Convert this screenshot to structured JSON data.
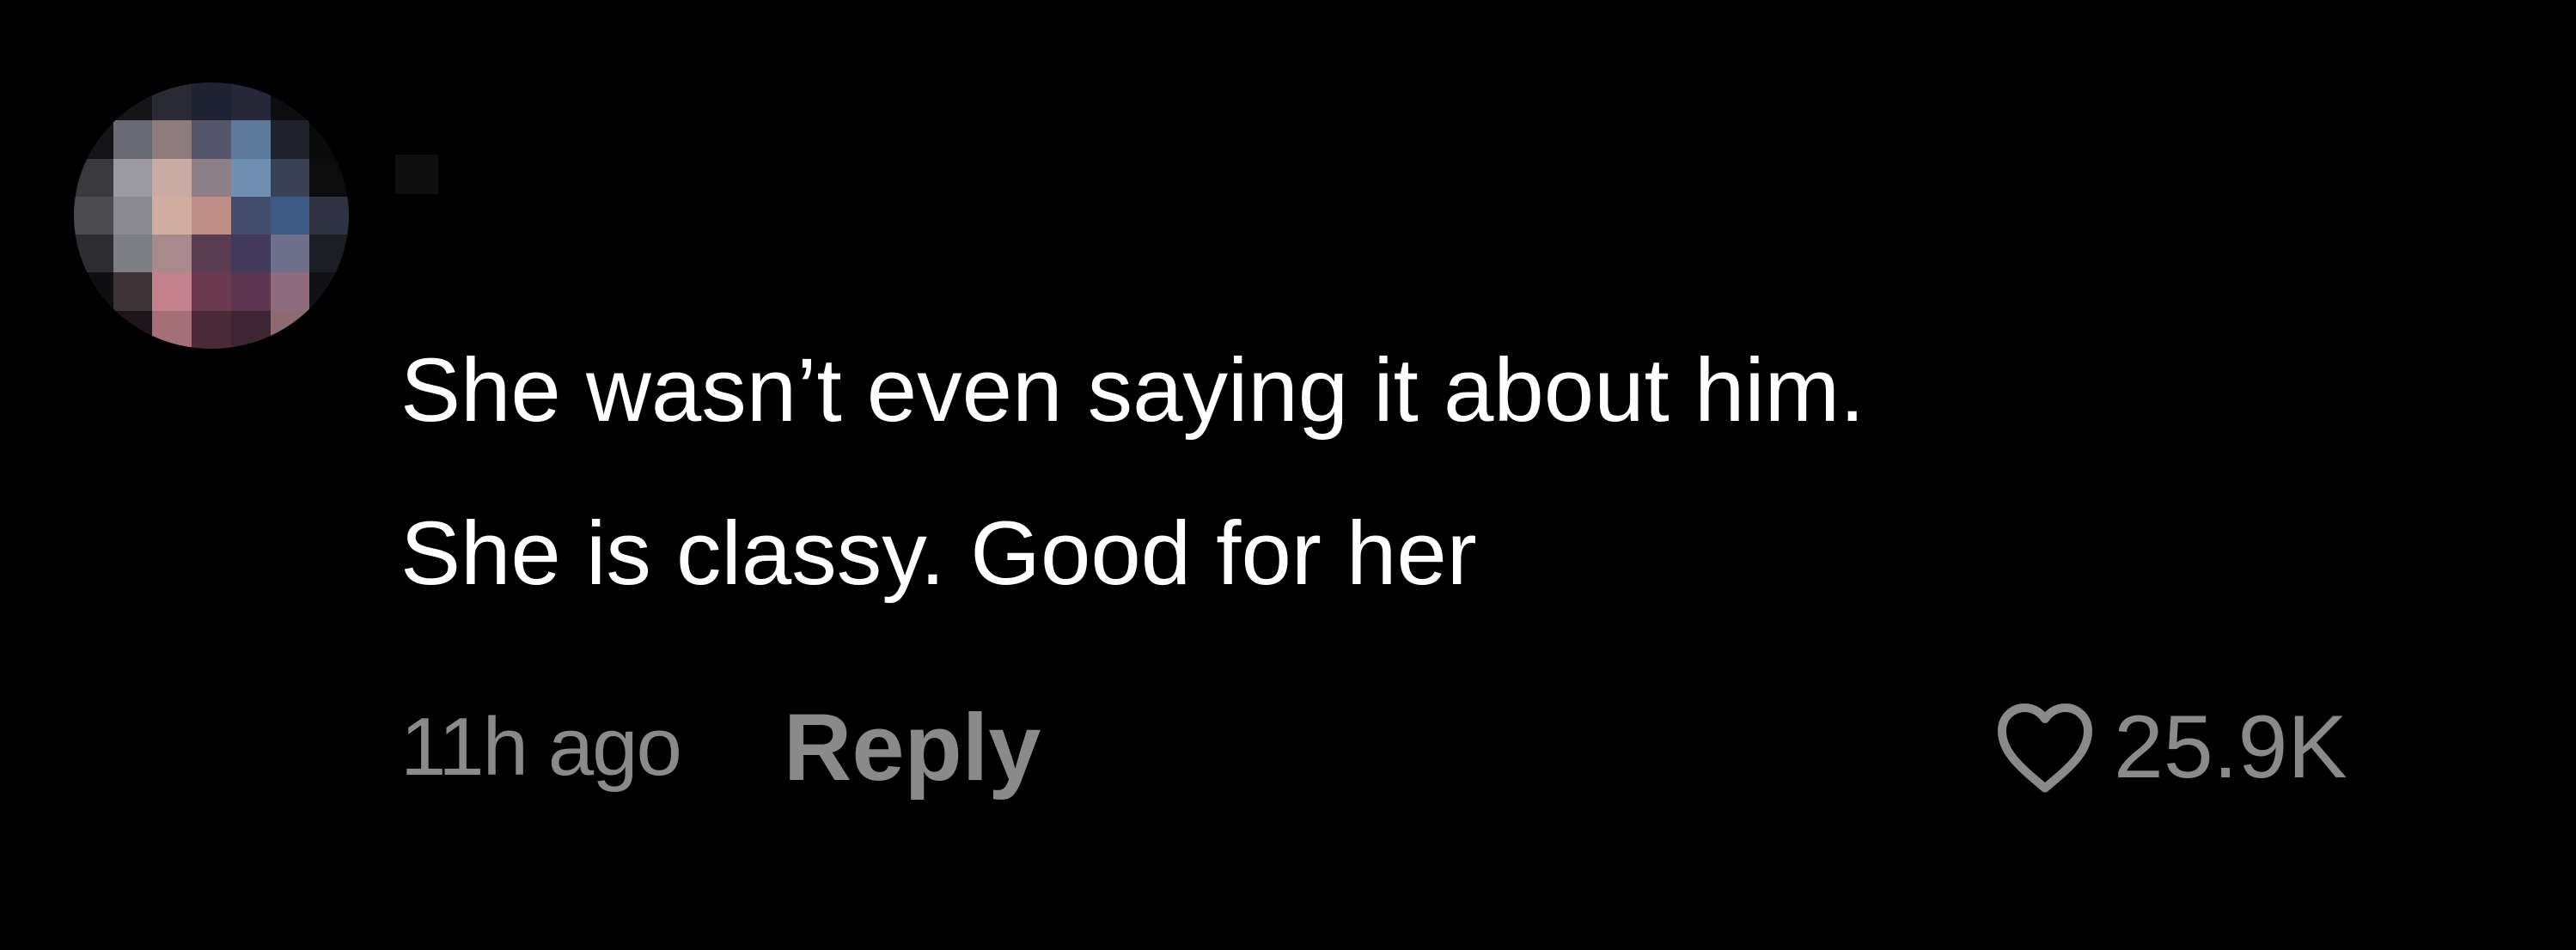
{
  "comment": {
    "text_lines": [
      "She wasn’t even saying it about him.",
      "She is classy. Good for her"
    ],
    "timestamp": "11h ago",
    "reply_label": "Reply",
    "like_count": "25.9K"
  },
  "icons": {
    "like": "heart-outline-icon"
  },
  "colors": {
    "background": "#000000",
    "text": "#ffffff",
    "secondary_text": "#8a8a8a"
  }
}
